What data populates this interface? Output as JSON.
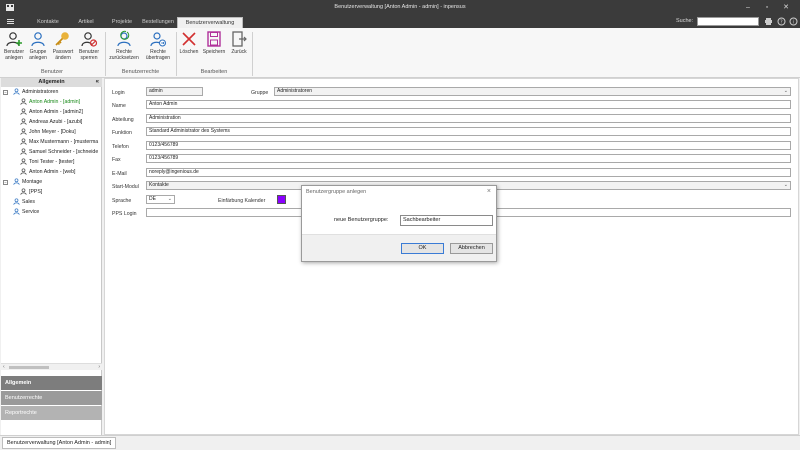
{
  "window": {
    "title": "Benutzerverwaltung [Anton Admin - admin] - inpensus"
  },
  "tabs": [
    {
      "label": "Kontakte"
    },
    {
      "label": "Artikel"
    },
    {
      "label": "Projekte"
    },
    {
      "label": "Bestellungen"
    },
    {
      "label": "Benutzerverwaltung"
    }
  ],
  "search": {
    "label": "Suche:",
    "value": ""
  },
  "ribbon": {
    "groups": [
      {
        "label": "Benutzer"
      },
      {
        "label": "Benutzerrechte"
      },
      {
        "label": "Bearbeiten"
      }
    ],
    "buttons": {
      "benutzer_anlegen": {
        "line1": "Benutzer",
        "line2": "anlegen"
      },
      "gruppe_anlegen": {
        "line1": "Gruppe",
        "line2": "anlegen"
      },
      "passwort_aendern": {
        "line1": "Passwort",
        "line2": "ändern"
      },
      "benutzer_sperren": {
        "line1": "Benutzer",
        "line2": "sperren"
      },
      "rechte_zuruecksetzen": {
        "line1": "Rechte",
        "line2": "zurücksetzen"
      },
      "rechte_uebertragen": {
        "line1": "Rechte",
        "line2": "übertragen"
      },
      "loeschen": {
        "line1": "Löschen"
      },
      "speichern": {
        "line1": "Speichern"
      },
      "zurueck": {
        "line1": "Zurück"
      }
    }
  },
  "leftpanel": {
    "header": "Allgemein",
    "tree": [
      {
        "label": "Administratoren",
        "level": 0,
        "expand": "−"
      },
      {
        "label": "Anton Admin - [admin]",
        "level": 1,
        "selected": true
      },
      {
        "label": "Anton Admin - [admin2]",
        "level": 1
      },
      {
        "label": "Andreas Azubi - [azubi]",
        "level": 1
      },
      {
        "label": "John Meyer - [Doku]",
        "level": 1
      },
      {
        "label": "Max Mustermann - [musterma",
        "level": 1
      },
      {
        "label": "Samuel Schneider - [schneide",
        "level": 1
      },
      {
        "label": "Toni Tester - [tester]",
        "level": 1
      },
      {
        "label": "Anton Admin - [web]",
        "level": 1
      },
      {
        "label": "Montage",
        "level": 0,
        "expand": "−"
      },
      {
        "label": "[PPS]",
        "level": 1
      },
      {
        "label": "Sales",
        "level": 0
      },
      {
        "label": "Service",
        "level": 0
      }
    ],
    "nav": [
      {
        "label": "Allgemein"
      },
      {
        "label": "Benutzerrechte"
      },
      {
        "label": "Reportrechte"
      }
    ]
  },
  "form": {
    "login": {
      "label": "Login",
      "value": "admin"
    },
    "gruppe": {
      "label": "Gruppe",
      "value": "Administratoren"
    },
    "name": {
      "label": "Name",
      "value": "Anton Admin"
    },
    "abteilung": {
      "label": "Abteilung",
      "value": "Administration"
    },
    "funktion": {
      "label": "Funktion",
      "value": "Standard Administrator des Systems"
    },
    "telefon": {
      "label": "Telefon",
      "value": "0123/456789"
    },
    "fax": {
      "label": "Fax",
      "value": "0123/456789"
    },
    "email": {
      "label": "E-Mail",
      "value": "noreply@ingenious.de"
    },
    "startmodul": {
      "label": "Start-Modul",
      "value": "Kontakte"
    },
    "sprache": {
      "label": "Sprache",
      "value": "DE"
    },
    "kalender": {
      "label": "Einfärbung Kalender",
      "color": "#8a00ff"
    },
    "pps_login": {
      "label": "PPS Login",
      "value": ""
    }
  },
  "dialog": {
    "title": "Benutzergruppe anlegen",
    "label": "neue Benutzergruppe:",
    "value": "Sachbearbeiter",
    "ok": "OK",
    "cancel": "Abbrechen"
  },
  "statusbar": {
    "tab": "Benutzerverwaltung [Anton Admin - admin]"
  }
}
